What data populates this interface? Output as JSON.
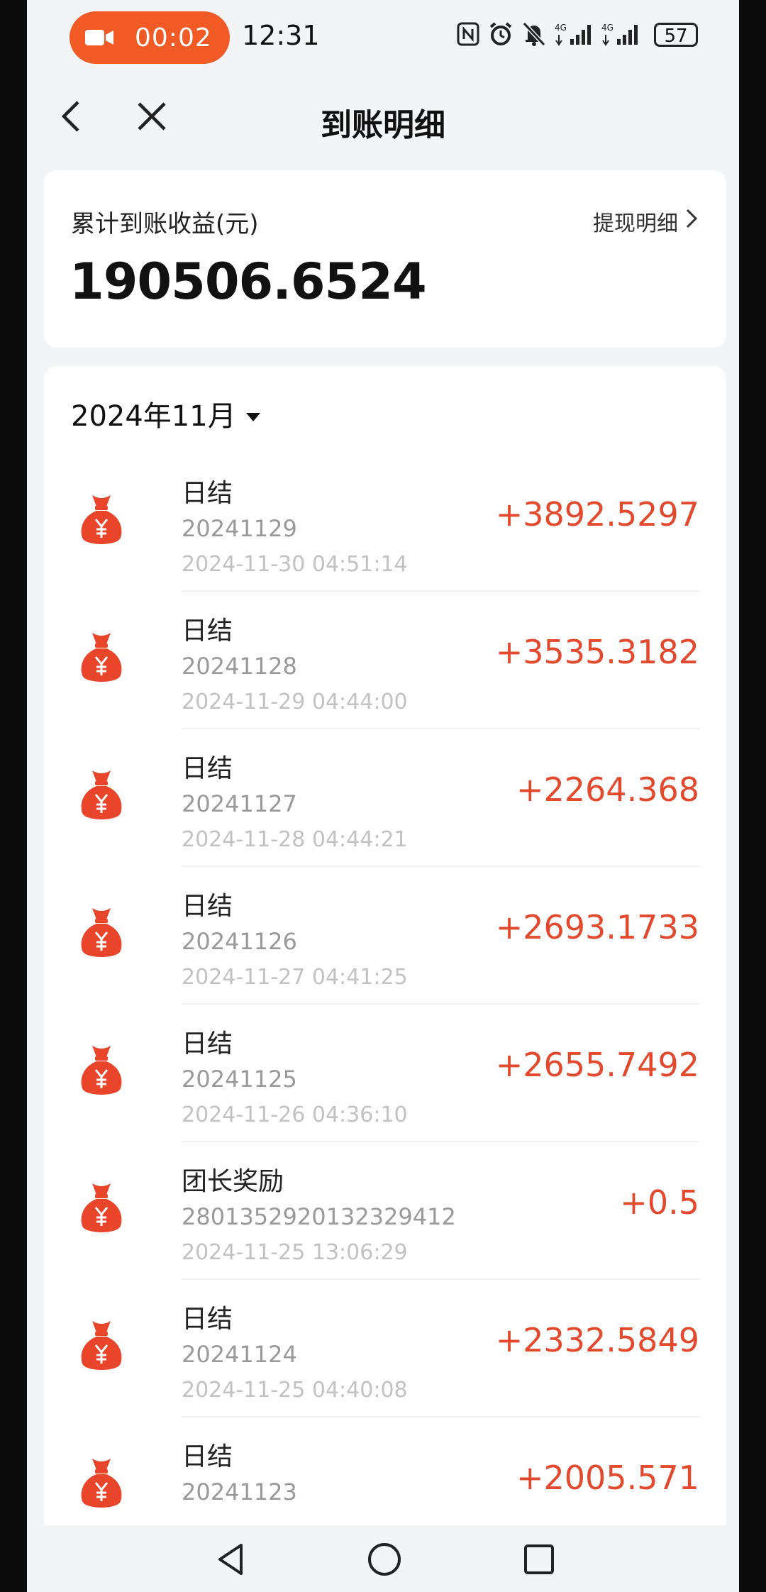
{
  "status_bar": {
    "recording_timer": "00:02",
    "clock": "12:31",
    "battery": "57",
    "network_1": "4G",
    "network_2": "4G"
  },
  "nav": {
    "title": "到账明细"
  },
  "summary": {
    "label": "累计到账收益(元)",
    "link": "提现明细",
    "total": "190506.6524"
  },
  "list": {
    "month": "2024年11月",
    "items": [
      {
        "title": "日结",
        "ref": "20241129",
        "time": "2024-11-30 04:51:14",
        "amount": "+3892.5297"
      },
      {
        "title": "日结",
        "ref": "20241128",
        "time": "2024-11-29 04:44:00",
        "amount": "+3535.3182"
      },
      {
        "title": "日结",
        "ref": "20241127",
        "time": "2024-11-28 04:44:21",
        "amount": "+2264.368"
      },
      {
        "title": "日结",
        "ref": "20241126",
        "time": "2024-11-27 04:41:25",
        "amount": "+2693.1733"
      },
      {
        "title": "日结",
        "ref": "20241125",
        "time": "2024-11-26 04:36:10",
        "amount": "+2655.7492"
      },
      {
        "title": "团长奖励",
        "ref": "2801352920132329412",
        "time": "2024-11-25 13:06:29",
        "amount": "+0.5"
      },
      {
        "title": "日结",
        "ref": "20241124",
        "time": "2024-11-25 04:40:08",
        "amount": "+2332.5849"
      },
      {
        "title": "日结",
        "ref": "20241123",
        "time": "",
        "amount": "+2005.571"
      }
    ]
  },
  "colors": {
    "accent": "#f15a24",
    "amount": "#e2492d",
    "page_bg": "#f2f4f5"
  },
  "icons": [
    "video-camera-icon",
    "nfc-icon",
    "alarm-icon",
    "mute-bell-icon",
    "signal-icon",
    "back-arrow-icon",
    "close-icon",
    "chevron-right-icon",
    "caret-down-icon",
    "money-bag-icon",
    "nav-back-icon",
    "nav-home-icon",
    "nav-recents-icon"
  ]
}
